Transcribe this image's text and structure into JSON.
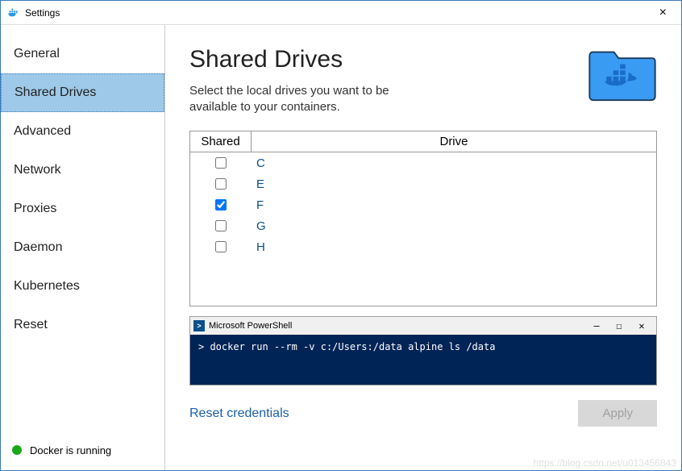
{
  "titlebar": {
    "title": "Settings",
    "close": "×"
  },
  "sidebar": {
    "items": [
      {
        "label": "General",
        "selected": false
      },
      {
        "label": "Shared Drives",
        "selected": true
      },
      {
        "label": "Advanced",
        "selected": false
      },
      {
        "label": "Network",
        "selected": false
      },
      {
        "label": "Proxies",
        "selected": false
      },
      {
        "label": "Daemon",
        "selected": false
      },
      {
        "label": "Kubernetes",
        "selected": false
      },
      {
        "label": "Reset",
        "selected": false
      }
    ]
  },
  "status": {
    "text": "Docker is running",
    "color": "#1aa81a"
  },
  "main": {
    "heading": "Shared Drives",
    "subheading": "Select the local drives you want to be available to your containers.",
    "table": {
      "headers": {
        "shared": "Shared",
        "drive": "Drive"
      },
      "rows": [
        {
          "drive": "C",
          "shared": false
        },
        {
          "drive": "E",
          "shared": false
        },
        {
          "drive": "F",
          "shared": true
        },
        {
          "drive": "G",
          "shared": false
        },
        {
          "drive": "H",
          "shared": false
        }
      ]
    },
    "powershell": {
      "title": "Microsoft PowerShell",
      "min": "—",
      "max": "☐",
      "close": "✕",
      "command": ">  docker run --rm -v c:/Users:/data alpine ls /data"
    },
    "reset_credentials": "Reset credentials",
    "apply": "Apply"
  },
  "watermark": "https://blog.csdn.net/u013456843"
}
